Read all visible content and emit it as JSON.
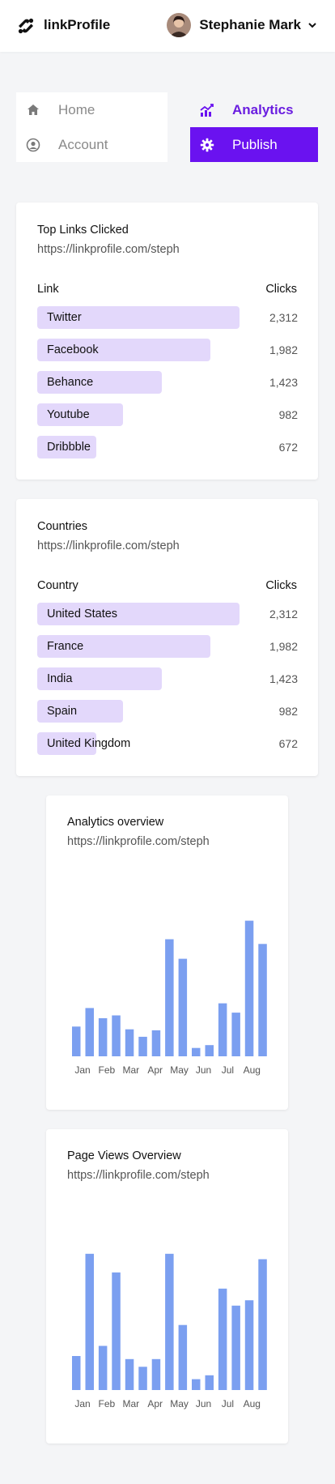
{
  "header": {
    "brand": "linkProfile",
    "user_name": "Stephanie Mark"
  },
  "nav": {
    "home": "Home",
    "account": "Account",
    "analytics": "Analytics",
    "publish": "Publish",
    "active": "Analytics",
    "accent_color": "#6a12f0"
  },
  "top_links": {
    "title": "Top Links Clicked",
    "url": "https://linkprofile.com/steph",
    "col_link": "Link",
    "col_clicks": "Clicks",
    "rows": [
      {
        "label": "Twitter",
        "value": "2,312",
        "clicks": 2312
      },
      {
        "label": "Facebook",
        "value": "1,982",
        "clicks": 1982
      },
      {
        "label": "Behance",
        "value": "1,423",
        "clicks": 1423
      },
      {
        "label": "Youtube",
        "value": "982",
        "clicks": 982
      },
      {
        "label": "Dribbble",
        "value": "672",
        "clicks": 672
      }
    ]
  },
  "countries": {
    "title": "Countries",
    "url": "https://linkprofile.com/steph",
    "col_country": "Country",
    "col_clicks": "Clicks",
    "rows": [
      {
        "label": "United States",
        "value": "2,312",
        "clicks": 2312
      },
      {
        "label": "France",
        "value": "1,982",
        "clicks": 1982
      },
      {
        "label": "India",
        "value": "1,423",
        "clicks": 1423
      },
      {
        "label": "Spain",
        "value": "982",
        "clicks": 982
      },
      {
        "label": "United Kingdom",
        "value": "672",
        "clicks": 672
      }
    ]
  },
  "chart_data": [
    {
      "type": "bar",
      "title": "Analytics overview",
      "subtitle": "https://linkprofile.com/steph",
      "tick_labels": [
        "Jan",
        "Feb",
        "Mar",
        "Apr",
        "May",
        "Jun",
        "Jul",
        "Aug"
      ],
      "values": [
        32,
        52,
        41,
        44,
        29,
        21,
        28,
        126,
        105,
        9,
        12,
        57,
        47,
        146,
        121
      ],
      "ylim": [
        0,
        150
      ],
      "color": "#7b9ff0",
      "grid": false
    },
    {
      "type": "bar",
      "title": "Page Views Overview",
      "subtitle": "https://linkprofile.com/steph",
      "tick_labels": [
        "Jan",
        "Feb",
        "Mar",
        "Apr",
        "May",
        "Jun",
        "Jul",
        "Aug"
      ],
      "values": [
        44,
        176,
        57,
        152,
        40,
        30,
        40,
        176,
        84,
        14,
        19,
        131,
        109,
        116,
        169
      ],
      "ylim": [
        0,
        180
      ],
      "color": "#7b9ff0",
      "grid": false
    }
  ]
}
